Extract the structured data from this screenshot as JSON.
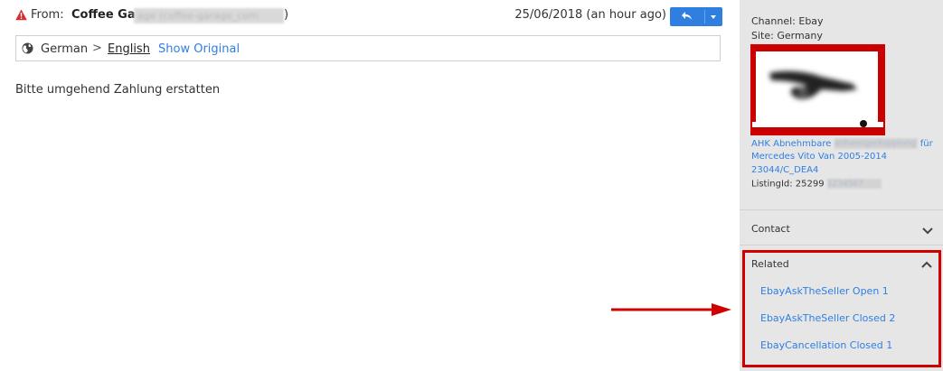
{
  "message": {
    "from_label": "From:",
    "from_name": "Coffee Gar",
    "from_email": "age (coffee-garage_com",
    "from_close": ")",
    "date": "25/06/2018 (an hour ago)",
    "body": "Bitte umgehend Zahlung erstatten"
  },
  "translation": {
    "source_language": "German",
    "separator": ">",
    "target_language": "English",
    "show_original": "Show Original"
  },
  "icons": {
    "warning": "warning-icon",
    "globe": "globe-icon",
    "reply": "reply-icon",
    "dropdown": "caret-down-icon",
    "arrow": "arrow-right-icon"
  },
  "sidebar": {
    "channel": "Channel: Ebay",
    "site": "Site: Germany",
    "listing": {
      "title_line1_start": "AHK Abnehmbare",
      "title_line1_redacted": "anhaengerkupplung",
      "title_line1_end": "für",
      "title_line2": "Mercedes Vito Van 2005-2014",
      "title_line3": "23044/C_DEA4",
      "listing_id_label": "ListingId: 25299",
      "listing_id_redacted": "1234567"
    },
    "contact": {
      "title": "Contact"
    },
    "related": {
      "title": "Related",
      "items": [
        {
          "label": "EbayAskTheSeller Open 1"
        },
        {
          "label": "EbayAskTheSeller Closed 2"
        },
        {
          "label": "EbayCancellation Closed 1"
        }
      ]
    }
  },
  "colors": {
    "accent": "#2f7fe0",
    "highlight": "#d10000",
    "warning": "#d32f2f"
  }
}
